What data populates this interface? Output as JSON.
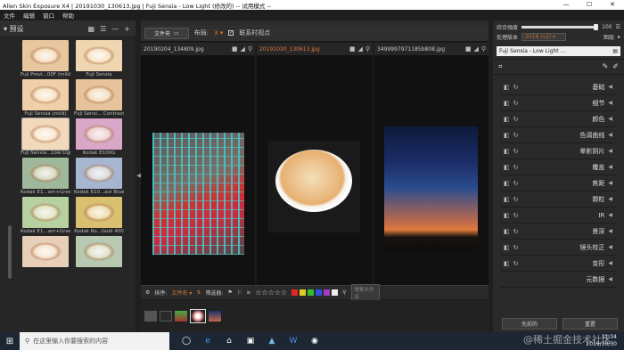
{
  "window": {
    "title": "Alien Skin Exposure X4 | 20191030_130613.jpg | Fuji Sensia - Low Light (修改的) -- 试用模式 --",
    "minimize": "—",
    "maximize": "☐",
    "close": "✕"
  },
  "menu": [
    "文件",
    "编辑",
    "窗口",
    "帮助"
  ],
  "left_panel": {
    "title": "预设",
    "presets": [
      {
        "label": "Fuji Provi...00F (mild)",
        "tint": "#e8c7a0"
      },
      {
        "label": "Fuji Sensia",
        "tint": "#f0d6b0"
      },
      {
        "label": "Fuji Sensia (mild)",
        "tint": "#f0d0aa"
      },
      {
        "label": "Fuji Sensi... Contrast",
        "tint": "#e6c39a"
      },
      {
        "label": "Fuji Sensia...Low Light",
        "tint": "#f2d9bc"
      },
      {
        "label": "Kodak E100G",
        "tint": "#d9a8c8"
      },
      {
        "label": "Kodak E1...am+Green",
        "tint": "#9fb89a"
      },
      {
        "label": "Kodak E10...ast Blue",
        "tint": "#a6b6d0"
      },
      {
        "label": "Kodak E1...am+Green",
        "tint": "#b6d0a0"
      },
      {
        "label": "Kodak Ro...Gold 400",
        "tint": "#d8c070"
      },
      {
        "label": "",
        "tint": "#e8d0b8"
      },
      {
        "label": "",
        "tint": "#b7c9b0"
      }
    ]
  },
  "toolbar": {
    "folder_button": "文件夹",
    "layout_label": "布局:",
    "layout_value": "3",
    "sync_label": "联系时视点"
  },
  "panes": [
    {
      "name": "20190204_134809.jpg",
      "active": false
    },
    {
      "name": "20191030_130613.jpg",
      "active": true
    },
    {
      "name": "3499997971185b808.jpg",
      "active": false
    }
  ],
  "bottom_bar": {
    "sort_label": "排序:",
    "sort_value": "文件名",
    "filter_label": "筛选器:",
    "rating_prefix": "≥",
    "stars": "☆☆☆☆☆",
    "color_labels": [
      "#e02828",
      "#e0d020",
      "#30c030",
      "#3050e0",
      "#a040c0",
      "#eeeeee"
    ],
    "search_placeholder": "搜索文件名"
  },
  "right_panel": {
    "opacity_label": "综合强度",
    "opacity_value": "100",
    "opacity_fraction": 1.0,
    "version_label": "处理版本",
    "version_value": "2018 (v2)",
    "layers_label": "图层",
    "layer_name": "Fuji Sensia - Low Light ...",
    "sections": [
      "基础",
      "细节",
      "颜色",
      "色调曲线",
      "晕影阴片",
      "覆盖",
      "焦距",
      "颗粒",
      "IR",
      "景深",
      "镜头校正",
      "变形",
      "元数据"
    ],
    "prev_button": "先前的",
    "reset_button": "重置"
  },
  "taskbar": {
    "search_placeholder": "在这里输入你要搜索的内容",
    "time": "11:34",
    "date": "2019/10/30",
    "watermark": "@稀土掘金技术社区"
  }
}
